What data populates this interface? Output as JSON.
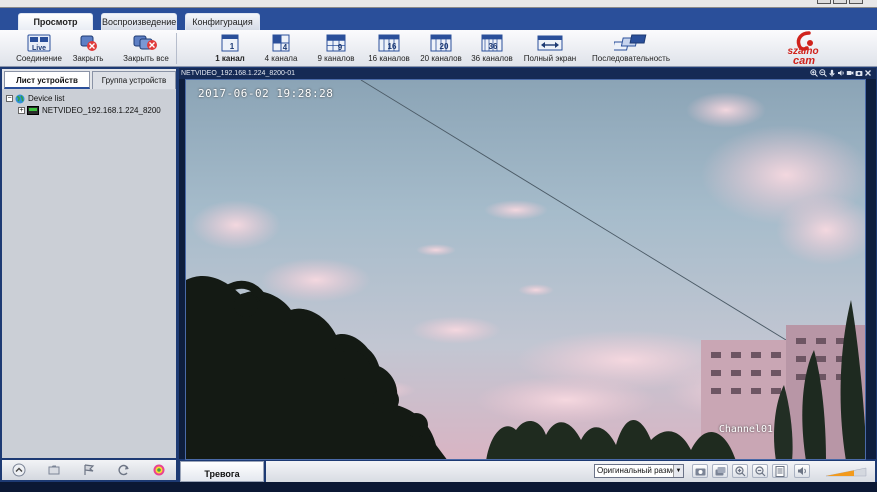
{
  "tabs": [
    {
      "label": "Просмотр",
      "active": true
    },
    {
      "label": "Воспроизведение",
      "active": false
    },
    {
      "label": "Конфигурация",
      "active": false
    }
  ],
  "toolbar": {
    "connect": "Соединение",
    "close": "Закрыть",
    "close_all": "Закрыть все",
    "ch1": "1 канал",
    "ch4": "4 канала",
    "ch9": "9 каналов",
    "ch16": "16 каналов",
    "ch20": "20 каналов",
    "ch36": "36 каналов",
    "fullscreen": "Полный экран",
    "sequence": "Последовательность",
    "icon_live": "Live",
    "icon_ch1": "1",
    "icon_ch4": "4",
    "icon_ch9": "9",
    "icon_ch16": "16",
    "icon_ch20": "20",
    "icon_ch36": "36"
  },
  "logo": {
    "line1": "szaino",
    "line2": "cam",
    "color": "#d0231c"
  },
  "left_panel": {
    "tabs": [
      {
        "label": "Лист устройств",
        "active": true
      },
      {
        "label": "Группа устройств",
        "active": false
      }
    ],
    "tree": {
      "root": "Device list",
      "device": "NETVIDEO_192.168.1.224_8200"
    }
  },
  "video": {
    "header": "NETVIDEO_192.168.1.224_8200-01",
    "timestamp": "2017-06-02  19:28:28",
    "channel_name": "Channel01"
  },
  "bottom": {
    "alarm_tab": "Тревога",
    "size_select": "Оригинальный размер",
    "volume_level": 0.7
  },
  "colors": {
    "frame_blue": "#1d3a73",
    "accent_blue": "#2a4f9a",
    "volume_orange": "#f29a1c"
  }
}
